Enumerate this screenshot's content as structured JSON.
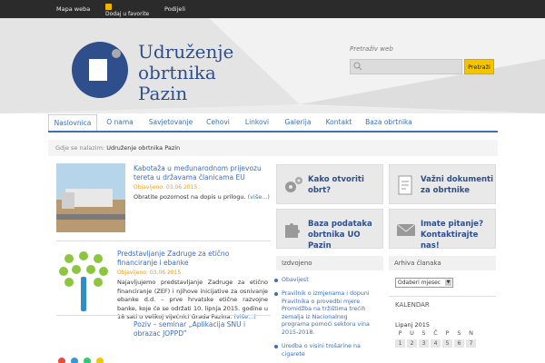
{
  "topbar": {
    "sitemap": "Mapa weba",
    "favorites": "Dodaj u favorite",
    "share": "Podijeli"
  },
  "logo": {
    "line1": "Udruženje",
    "line2": "obrtnika",
    "line3": "Pazin"
  },
  "search": {
    "label": "Pretraživ web",
    "button": "Pretraži"
  },
  "nav": {
    "items": [
      "Naslovnica",
      "O nama",
      "Savjetovanje",
      "Cehovi",
      "Linkovi",
      "Galerija",
      "Kontakt",
      "Baza obrtnika"
    ]
  },
  "breadcrumb": {
    "prefix": "Gdje se nalazim:",
    "current": "Udruženje obrtnika Pazin"
  },
  "articles": [
    {
      "title": "Kabotaža u međunarodnom prijevozu tereta u državama članicama EU",
      "meta": "Objavljeno: 03.06.2015.",
      "body": "Obratite pozornost na dopis u prilogu.",
      "more": "(više...)"
    },
    {
      "title": "Predstavljanje Zadruge za etično financiranje i ebanke",
      "meta": "Objavljeno: 03.06.2015.",
      "body": "Najavljujemo predstavljanje Zadruge za etično financiranje (ZEF) i njihove inicijative za osnivanje ebanke d.d. – prve hrvatske etične razvojne banke, koje će se održati 10. lipnja 2015. godine u 18 sati u velikoj vijećnici Grada Pazina.",
      "more": "(više...)"
    },
    {
      "title": "Poziv – seminar „Aplikacija SNU i obrazac JOPPD”"
    }
  ],
  "boxes": [
    {
      "line1": "Kako otvoriti",
      "line2": "obrt?"
    },
    {
      "line1": "Važni dokumenti",
      "line2": "za obrtnike"
    },
    {
      "line1": "Baza podataka",
      "line2": "obrtnika UO Pazin"
    },
    {
      "line1": "Imate pitanje?",
      "line2": "Kontaktirajte nas!"
    }
  ],
  "izdvojeno": {
    "title": "Izdvojeno",
    "items": [
      "Obavijest",
      "Pravilnik o izmjenama i dopuni Pravilnika o provedbi mjere Promidžba na tržištima trećih zemalja iz Nacionalnog programa pomoći sektoru vina 2015-2018.",
      "Uredba o visini trošarine na cigarete"
    ]
  },
  "archive": {
    "title": "Arhiva članaka",
    "select": "Odaberi mjesec"
  },
  "calendar": {
    "title": "KALENDAR",
    "month": "Lipanj 2015",
    "days": [
      "P",
      "U",
      "S",
      "Č",
      "P",
      "S",
      "N"
    ],
    "first_row": [
      "1",
      "2",
      "3",
      "4",
      "5",
      "6",
      "7"
    ]
  },
  "colors": {
    "brand": "#2e4f8c",
    "link": "#3b6fb6",
    "accent": "#f5c400",
    "meta": "#f0a000"
  }
}
